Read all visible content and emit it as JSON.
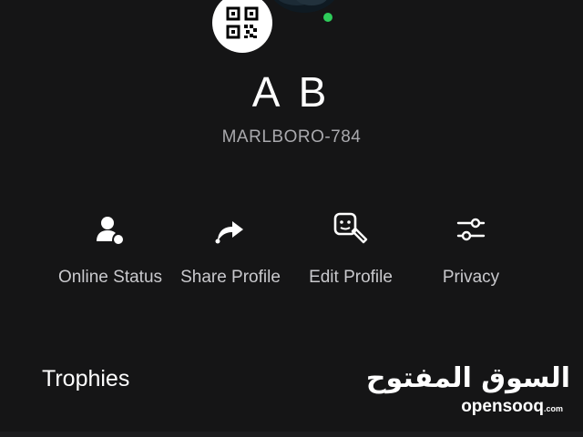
{
  "profile": {
    "display_name": "A B",
    "username": "MARLBORO-784",
    "online": true
  },
  "actions": [
    {
      "label": "Online Status",
      "icon": "person-status-icon"
    },
    {
      "label": "Share Profile",
      "icon": "share-arrow-icon"
    },
    {
      "label": "Edit Profile",
      "icon": "edit-face-icon"
    },
    {
      "label": "Privacy",
      "icon": "sliders-icon"
    }
  ],
  "sections": {
    "trophies_title": "Trophies"
  },
  "watermark": {
    "arabic": "السوق المفتوح",
    "latin": "opensooq",
    "tld": ".com"
  },
  "colors": {
    "background": "#151516",
    "online_dot": "#2ecc5a",
    "text_primary": "#ffffff",
    "text_secondary": "#a9a9ad"
  }
}
